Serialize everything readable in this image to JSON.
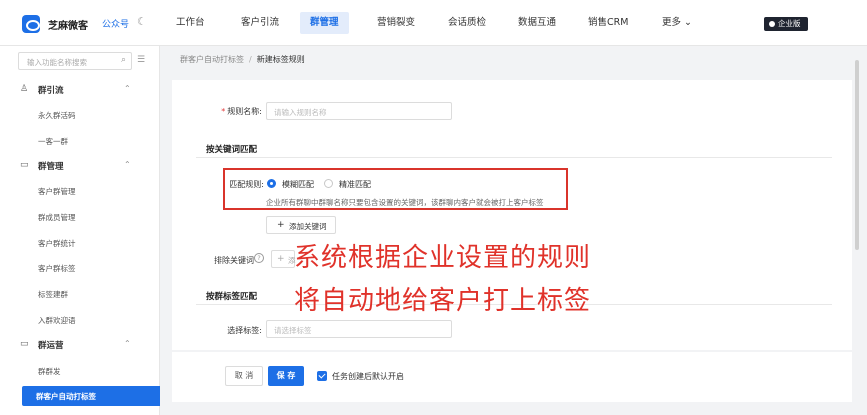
{
  "header": {
    "brand": "芝麻微客",
    "account": "公众号",
    "nav": [
      {
        "label": "工作台"
      },
      {
        "label": "客户引流"
      },
      {
        "label": "群管理"
      },
      {
        "label": "营销裂变"
      },
      {
        "label": "会话质检"
      },
      {
        "label": "数据互通"
      },
      {
        "label": "销售CRM"
      },
      {
        "label": "更多 ⌄"
      }
    ],
    "enterprise_badge": "企业版"
  },
  "sidebar": {
    "search_placeholder": "输入功能名称搜索",
    "groups": [
      {
        "label": "群引流",
        "items": [
          "永久群活码",
          "一客一群"
        ]
      },
      {
        "label": "群管理",
        "items": [
          "客户群管理",
          "群成员管理",
          "客户群统计",
          "客户群标签",
          "标签建群",
          "入群欢迎语"
        ]
      },
      {
        "label": "群运营",
        "items": [
          "群群发",
          "群客户自动打标签"
        ]
      }
    ]
  },
  "breadcrumb": {
    "parent": "群客户自动打标签",
    "separator": "/",
    "current": "新建标签规则"
  },
  "form": {
    "rule_name_label": "规则名称:",
    "rule_name_placeholder": "请输入规则名称",
    "section_keyword": "按关键词匹配",
    "match_rule_label": "匹配规则:",
    "option_fuzzy": "模糊匹配",
    "option_exact": "精准匹配",
    "hint": "企业所有群聊中群聊名称只要包含设置的关键词，该群聊内客户就会被打上客户标签",
    "add_keyword": "添加关键词",
    "exclude_label": "排除关键词",
    "exclude_add": "添",
    "section_tag": "按群标签匹配",
    "select_tag_label": "选择标签:",
    "select_tag_placeholder": "请选择标签"
  },
  "overlay": {
    "line1": "系统根据企业设置的规则",
    "line2": "将自动地给客户打上标签"
  },
  "footer": {
    "cancel": "取 消",
    "save": "保 存",
    "checkbox_label": "任务创建后默认开启"
  },
  "colors": {
    "primary": "#1d6fe6",
    "highlight": "#d9342b",
    "overlay_text": "#e0322a"
  }
}
